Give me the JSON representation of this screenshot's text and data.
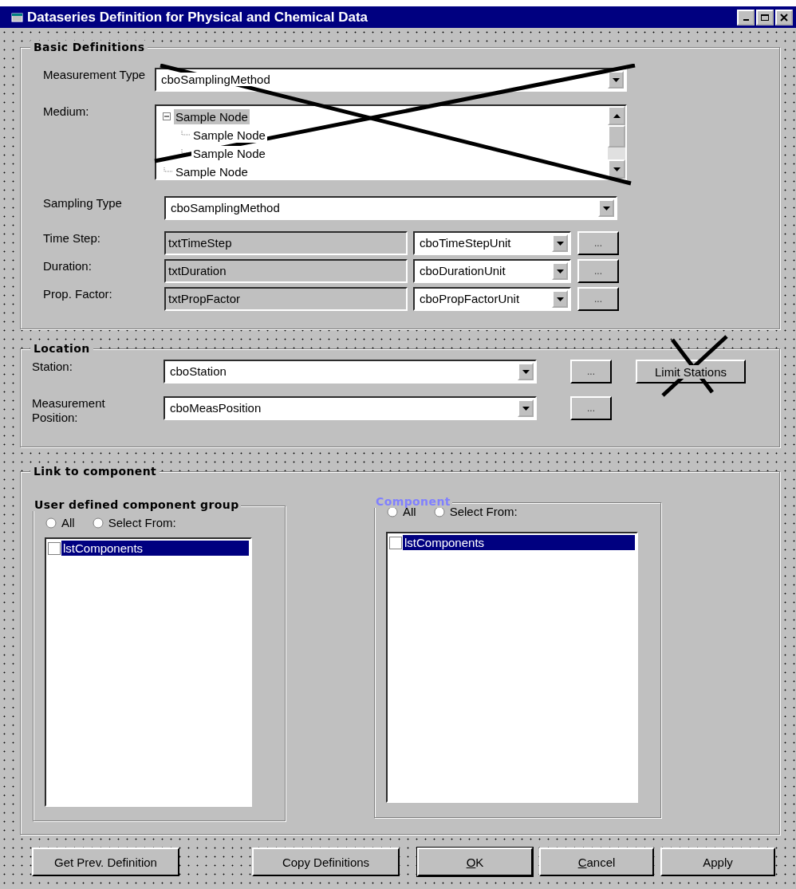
{
  "window": {
    "title": "Dataseries Definition for Physical and Chemical Data"
  },
  "basic": {
    "legend": "Basic Definitions",
    "measurement_type": {
      "label": "Measurement Type",
      "value": "cboSamplingMethod"
    },
    "medium": {
      "label": "Medium:",
      "tree": [
        {
          "label": "Sample Node",
          "expanded": true,
          "selected": true,
          "children": [
            {
              "label": "Sample Node",
              "selected": false
            },
            {
              "label": "Sample Node",
              "selected": false
            }
          ]
        },
        {
          "label": "Sample Node",
          "selected": false
        }
      ]
    },
    "sampling_type": {
      "label": "Sampling Type",
      "value": "cboSamplingMethod"
    },
    "unit_rows": [
      {
        "label": "Time Step:",
        "text": "txtTimeStep",
        "unit": "cboTimeStepUnit",
        "button": "..."
      },
      {
        "label": "Duration:",
        "text": "txtDuration",
        "unit": "cboDurationUnit",
        "button": "..."
      },
      {
        "label": "Prop. Factor:",
        "text": "txtPropFactor",
        "unit": "cboPropFactorUnit",
        "button": "..."
      }
    ]
  },
  "location": {
    "legend": "Location",
    "rows": [
      {
        "label": "Station:",
        "value": "cboStation",
        "button": "...",
        "extra_button": "Limit Stations"
      },
      {
        "label": "Measurement Position:",
        "value": "cboMeasPosition",
        "button": "..."
      }
    ]
  },
  "link": {
    "legend": "Link to component",
    "groups": [
      {
        "legend": "User defined component group",
        "color": "#000000",
        "radios": [
          {
            "label": "All",
            "selected": false
          },
          {
            "label": "Select From:",
            "selected": false
          }
        ],
        "items": [
          {
            "label": "lstComponents",
            "checked": false,
            "selected": true
          }
        ]
      },
      {
        "legend": "Component",
        "color": "#8080ff",
        "radios": [
          {
            "label": "All",
            "selected": false
          },
          {
            "label": "Select From:",
            "selected": false
          }
        ],
        "items": [
          {
            "label": "lstComponents",
            "checked": false,
            "selected": true
          }
        ]
      }
    ]
  },
  "buttons": [
    {
      "label": "Get Prev. Definition",
      "default": false
    },
    {
      "label": "Copy Definitions",
      "default": false
    },
    {
      "label": "OK",
      "default": true,
      "mnemonic": true
    },
    {
      "label": "Cancel",
      "default": false,
      "mnemonic": true
    },
    {
      "label": "Apply",
      "default": false
    }
  ]
}
